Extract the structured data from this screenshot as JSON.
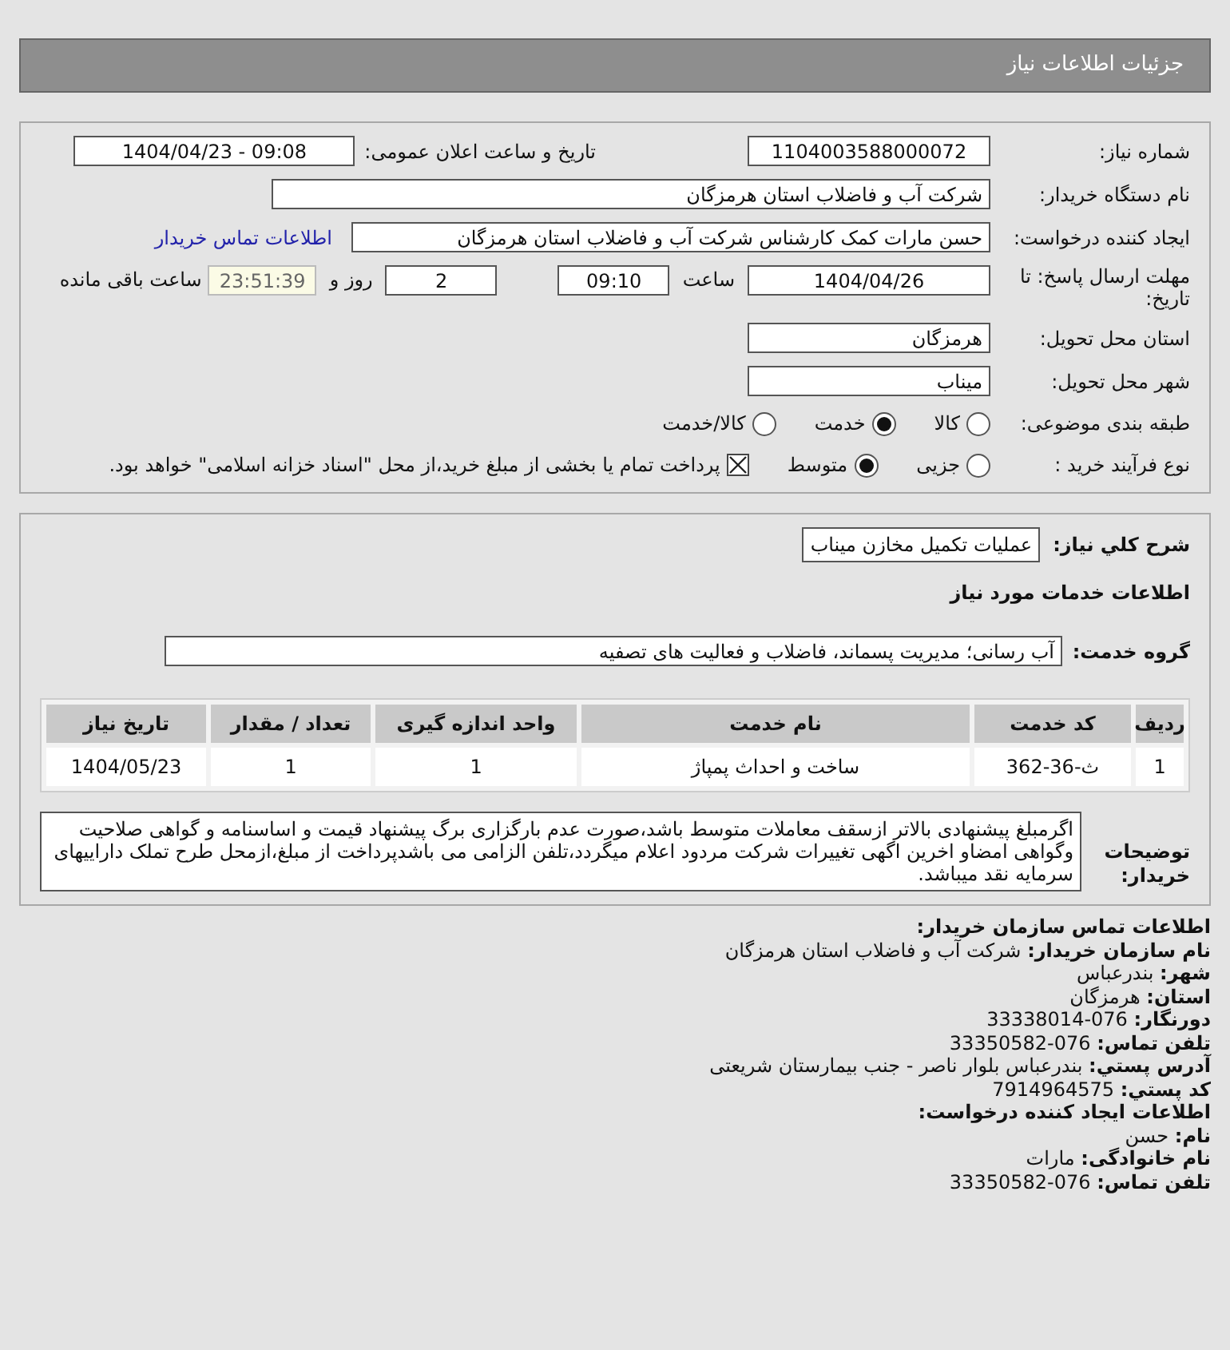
{
  "header": {
    "title": "جزئیات اطلاعات نیاز"
  },
  "details": {
    "need_number": {
      "label": "شماره نیاز:",
      "value": "1104003588000072"
    },
    "announce": {
      "label": "تاریخ و ساعت اعلان عمومی:",
      "value": "1404/04/23 - 09:08"
    },
    "buyer": {
      "label": "نام دستگاه خریدار:",
      "value": "شرکت آب و فاضلاب استان هرمزگان"
    },
    "creator": {
      "label": "ایجاد کننده درخواست:",
      "value": "حسن مارات کمک کارشناس شرکت آب و فاضلاب استان هرمزگان",
      "link": "اطلاعات تماس خریدار"
    },
    "deadline": {
      "label": "مهلت ارسال پاسخ: تا تاریخ:",
      "date": "1404/04/26",
      "time_label": "ساعت",
      "time": "09:10",
      "days": "2",
      "days_label": "روز و",
      "remaining": "23:51:39",
      "remaining_label": "ساعت باقی مانده"
    },
    "province": {
      "label": "استان محل تحویل:",
      "value": "هرمزگان"
    },
    "city": {
      "label": "شهر محل تحویل:",
      "value": "میناب"
    },
    "category": {
      "label": "طبقه بندی موضوعی:",
      "options": [
        {
          "label": "کالا",
          "selected": false
        },
        {
          "label": "خدمت",
          "selected": true
        },
        {
          "label": "کالا/خدمت",
          "selected": false
        }
      ]
    },
    "process": {
      "label": "نوع فرآیند خرید :",
      "options": [
        {
          "label": "جزیی",
          "selected": false
        },
        {
          "label": "متوسط",
          "selected": true
        }
      ],
      "payment": {
        "label": "پرداخت تمام یا بخشی از مبلغ خرید،از محل \"اسناد خزانه اسلامی\" خواهد بود.",
        "checked": true
      }
    }
  },
  "needs": {
    "summary": {
      "label": "شرح کلي نیاز:",
      "value": "عملیات تکمیل مخازن میناب"
    },
    "services_title": "اطلاعات خدمات مورد نیاز",
    "service_group": {
      "label": "گروه خدمت:",
      "value": "آب رسانی؛ مدیریت پسماند، فاضلاب و فعالیت های تصفیه"
    },
    "table": {
      "columns": [
        "ردیف",
        "کد خدمت",
        "نام خدمت",
        "واحد اندازه گیری",
        "تعداد / مقدار",
        "تاریخ نیاز"
      ],
      "rows": [
        [
          "1",
          "ث-36-362",
          "ساخت و احداث پمپاژ",
          "1",
          "1",
          "1404/05/23"
        ]
      ]
    },
    "notes": {
      "label": "توضیحات خریدار:",
      "text": "اگرمبلغ پیشنهادی بالاتر ازسقف معاملات متوسط باشد،صورت عدم بارگزاری برگ پیشنهاد قیمت و اساسنامه و گواهی صلاحیت وگواهی امضاو اخرین اگهی تغییرات شرکت مردود اعلام میگردد،تلفن الزامی می باشدپرداخت از مبلغ،ازمحل طرح تملک داراییهای سرمایه نقد میباشد."
    }
  },
  "contact": [
    {
      "label": "اطلاعات تماس سازمان خریدار:"
    },
    {
      "label": "نام سازمان خریدار:",
      "value": "شرکت آب و فاضلاب استان هرمزگان"
    },
    {
      "label": "شهر:",
      "value": "بندرعباس"
    },
    {
      "label": "استان:",
      "value": "هرمزگان"
    },
    {
      "label": "دورنگار:",
      "value": "33338014-076"
    },
    {
      "label": "تلفن تماس:",
      "value": "33350582-076"
    },
    {
      "label": "آدرس پستي:",
      "value": "بندرعباس بلوار ناصر - جنب بیمارستان شریعتی"
    },
    {
      "label": "کد پستي:",
      "value": "7914964575"
    },
    {
      "label": "اطلاعات ایجاد کننده درخواست:"
    },
    {
      "label": "نام:",
      "value": "حسن"
    },
    {
      "label": "نام خانوادگی:",
      "value": "مارات"
    },
    {
      "label": "تلفن تماس:",
      "value": "33350582-076"
    }
  ]
}
